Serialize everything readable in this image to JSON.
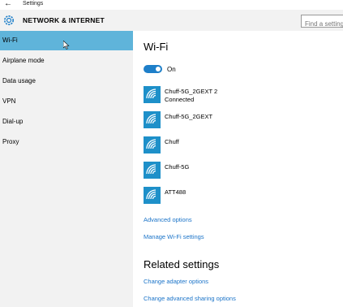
{
  "window": {
    "title": "Settings"
  },
  "header": {
    "title": "NETWORK & INTERNET",
    "search_placeholder": "Find a setting"
  },
  "sidebar": {
    "items": [
      {
        "label": "Wi-Fi",
        "selected": true
      },
      {
        "label": "Airplane mode"
      },
      {
        "label": "Data usage"
      },
      {
        "label": "VPN"
      },
      {
        "label": "Dial-up"
      },
      {
        "label": "Proxy"
      }
    ]
  },
  "main": {
    "title": "Wi-Fi",
    "toggle": {
      "label": "On",
      "state": true
    },
    "networks": [
      {
        "name": "Chuff-5G_2GEXT 2",
        "status": "Connected"
      },
      {
        "name": "Chuff-5G_2GEXT",
        "status": ""
      },
      {
        "name": "Chuff",
        "status": ""
      },
      {
        "name": "Chuff-5G",
        "status": ""
      },
      {
        "name": "ATT488",
        "status": ""
      }
    ],
    "links": {
      "advanced_options": "Advanced options",
      "manage_wifi": "Manage Wi-Fi settings"
    },
    "related": {
      "title": "Related settings",
      "change_adapter": "Change adapter options",
      "change_sharing": "Change advanced sharing options"
    }
  },
  "colors": {
    "accent": "#1e7fc9",
    "selected": "#5fb4da",
    "link": "#1a73c8"
  }
}
